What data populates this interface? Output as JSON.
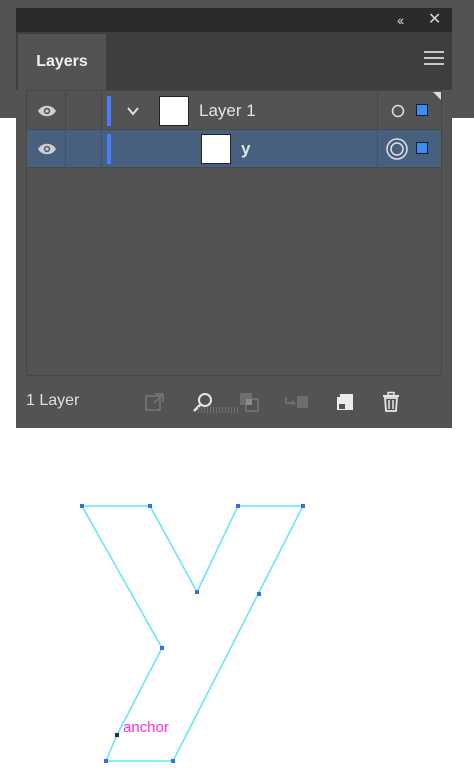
{
  "window": {
    "collapse_glyph": "‹‹",
    "close_glyph": "✕"
  },
  "panel": {
    "tab_label": "Layers",
    "menu_icon": "hamburger-menu-icon"
  },
  "layers": [
    {
      "name": "Layer 1",
      "visible": true,
      "expanded": true,
      "color": "#4a7cff",
      "target": "circle",
      "selected": true
    },
    {
      "name": "y",
      "visible": true,
      "color": "#4a7cff",
      "target": "double-circle",
      "selected": true,
      "highlighted": true
    }
  ],
  "footer": {
    "layer_count": "1 Layer",
    "icons": [
      "collect-for-export-icon",
      "locate-object-icon",
      "make-clipping-mask-icon",
      "create-sublayer-icon",
      "create-new-layer-icon",
      "delete-icon"
    ]
  },
  "artwork": {
    "path_color": "#5ee6f5",
    "anchor_color": "#3a6fd8",
    "label": "anchor",
    "label_color": "#ff2ee0"
  }
}
